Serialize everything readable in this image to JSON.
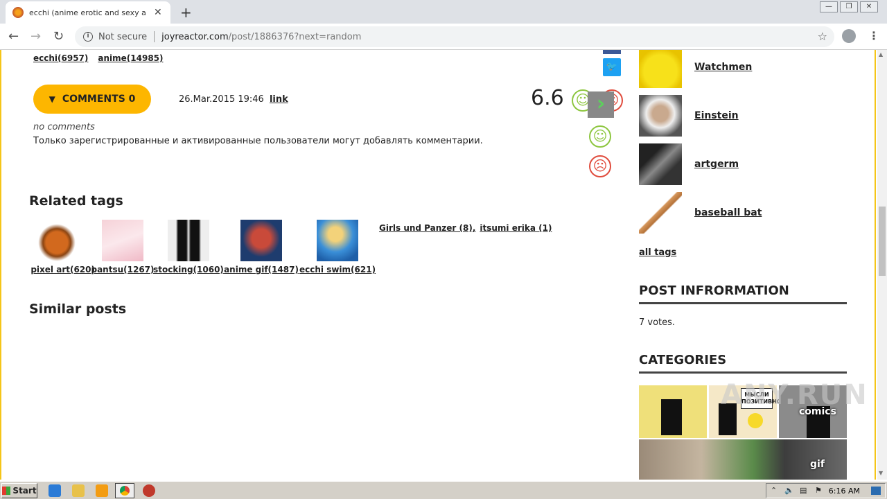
{
  "browser": {
    "tab_title": "ecchi (anime erotic and sexy anime g",
    "not_secure": "Not secure",
    "url_host": "joyreactor.com",
    "url_path": "/post/1886376?next=random"
  },
  "post": {
    "top_tags": [
      "ecchi(6957)",
      "anime(14985)"
    ],
    "comments_label": "COMMENTS 0",
    "date": "26.Mar.2015 19:46",
    "link": "link",
    "rating": "6.6",
    "no_comments": "no comments",
    "only_registered": "Только зарегистрированные и активированные пользователи могут добавлять комментарии."
  },
  "related": {
    "heading": "Related tags",
    "tags": [
      "pixel art(620)",
      "pantsu(1267)",
      "stocking(1060)",
      "anime gif(1487)",
      "ecchi swim(621)"
    ],
    "text_tags": [
      "Girls und Panzer (8),",
      "itsumi erika (1)"
    ]
  },
  "similar": {
    "heading": "Similar posts"
  },
  "sidebar": {
    "tags": [
      "Watchmen",
      "Einstein",
      "artgerm",
      "baseball bat"
    ],
    "all_tags": "all tags",
    "post_info_heading": "POST INFRORMATION",
    "votes": "7 votes.",
    "categories_heading": "CATEGORIES",
    "categories": [
      "comics",
      "gif"
    ],
    "category_poster_text": "МЫСЛИ ПОЗИТИВНО"
  },
  "taskbar": {
    "start": "Start",
    "clock": "6:16 AM"
  },
  "watermark": "ANY.RUN",
  "colors": {
    "accent": "#fdb600",
    "good": "#8dc63f",
    "bad": "#e04b3c",
    "frame": "#f5c518"
  }
}
